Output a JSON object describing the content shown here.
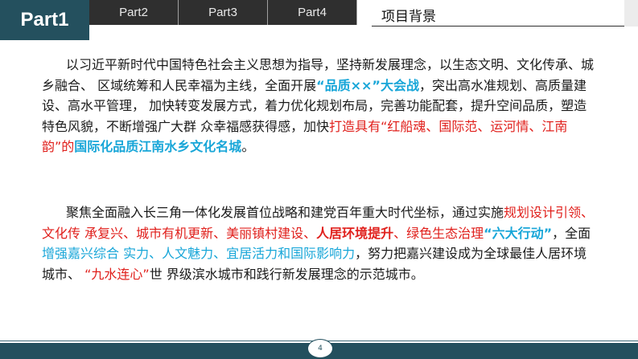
{
  "header": {
    "active_part": "Part1",
    "tabs": [
      "Part2",
      "Part3",
      "Part4"
    ],
    "title": "项目背景"
  },
  "paragraph1": [
    {
      "t": "以习近平新时代中国特色社会主义思想为指导，坚持新发展理念，以生态文明、文化传承、城乡融合、 区域统筹和人民幸福为主线，全面开展",
      "s": "plain"
    },
    {
      "t": "“品质××”大会战",
      "s": "blue-bold"
    },
    {
      "t": "，突出高水准规划、高质量建设、高水平管理， 加快转变发展方式，着力优化规划布局，完善功能配套，提升空间品质，塑造特色风貌，不断增强广大群 众幸福感获得感，加快",
      "s": "plain"
    },
    {
      "t": "打造具有“红船魂、国际范、运河情、江南韵”的",
      "s": "red"
    },
    {
      "t": "国际化品质江南水乡文化名城",
      "s": "blue-bold"
    },
    {
      "t": "。",
      "s": "plain"
    }
  ],
  "paragraph2": [
    {
      "t": "聚焦全面融入长三角一体化发展首位战略和建党百年重大时代坐标，通过实施",
      "s": "plain"
    },
    {
      "t": "规划设计引领、文化传 承复兴、城市有机更新、美丽镇村建设、",
      "s": "red"
    },
    {
      "t": "人居环境提升",
      "s": "red-bold"
    },
    {
      "t": "、绿色生态治理",
      "s": "red"
    },
    {
      "t": "“六大行动”",
      "s": "blue-bold"
    },
    {
      "t": "，全面",
      "s": "plain"
    },
    {
      "t": "增强嘉兴综合 实力、人文魅力、宜居活力和国际影响力",
      "s": "blue"
    },
    {
      "t": "，努力把嘉兴建设成为全球最佳人居环境城市、 ",
      "s": "plain"
    },
    {
      "t": "“九水连心”",
      "s": "red"
    },
    {
      "t": "世 界级滨水城市和践行新发展理念的示范城市。",
      "s": "plain"
    }
  ],
  "footer": {
    "page": "4"
  },
  "colors": {
    "header_teal": "#24505e",
    "tab_dark": "#2f2f2f",
    "red": "#e0201c",
    "blue": "#18a6d8"
  }
}
